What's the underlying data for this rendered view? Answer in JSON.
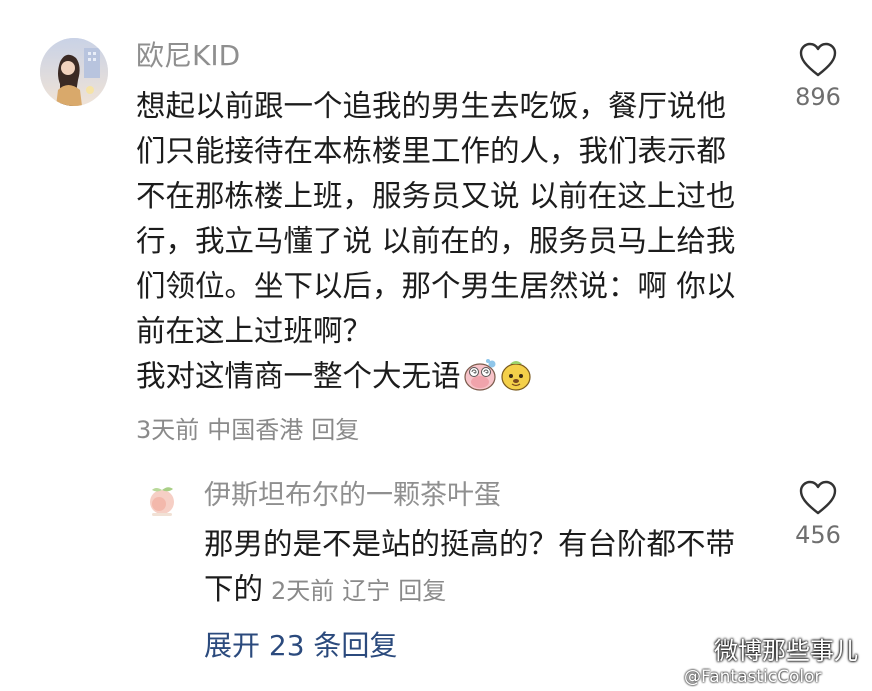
{
  "comment": {
    "username": "欧尼KID",
    "lines": [
      "想起以前跟一个追我的男生去吃饭，餐厅说他",
      "们只能接待在本栋楼里工作的人，我们表示都",
      "不在那栋楼上班，服务员又说 以前在这上过也",
      "行，我立马懂了说 以前在的，服务员马上给我",
      "们领位。坐下以后，那个男生居然说：啊 你以",
      "前在这上过班啊？",
      "我对这情商一整个大无语"
    ],
    "emojis": [
      "dizzy-face-emoji",
      "dog-face-emoji"
    ],
    "time": "3天前",
    "location": "中国香港",
    "reply_label": "回复",
    "like_count": "896",
    "like_icon": "heart-outline-icon"
  },
  "reply": {
    "username": "伊斯坦布尔的一颗茶叶蛋",
    "lines": [
      "那男的是不是站的挺高的？有台阶都不带",
      "下的"
    ],
    "time": "2天前",
    "location": "辽宁",
    "reply_label": "回复",
    "like_count": "456",
    "like_icon": "heart-outline-icon"
  },
  "expand_label": "展开 23 条回复",
  "watermark": {
    "title": "微博那些事儿",
    "handle": "@FantasticColor",
    "icon": "wechat-logo"
  },
  "colors": {
    "text": "#1c1c1c",
    "muted": "#8f8f8f",
    "link": "#2b4a7d"
  }
}
